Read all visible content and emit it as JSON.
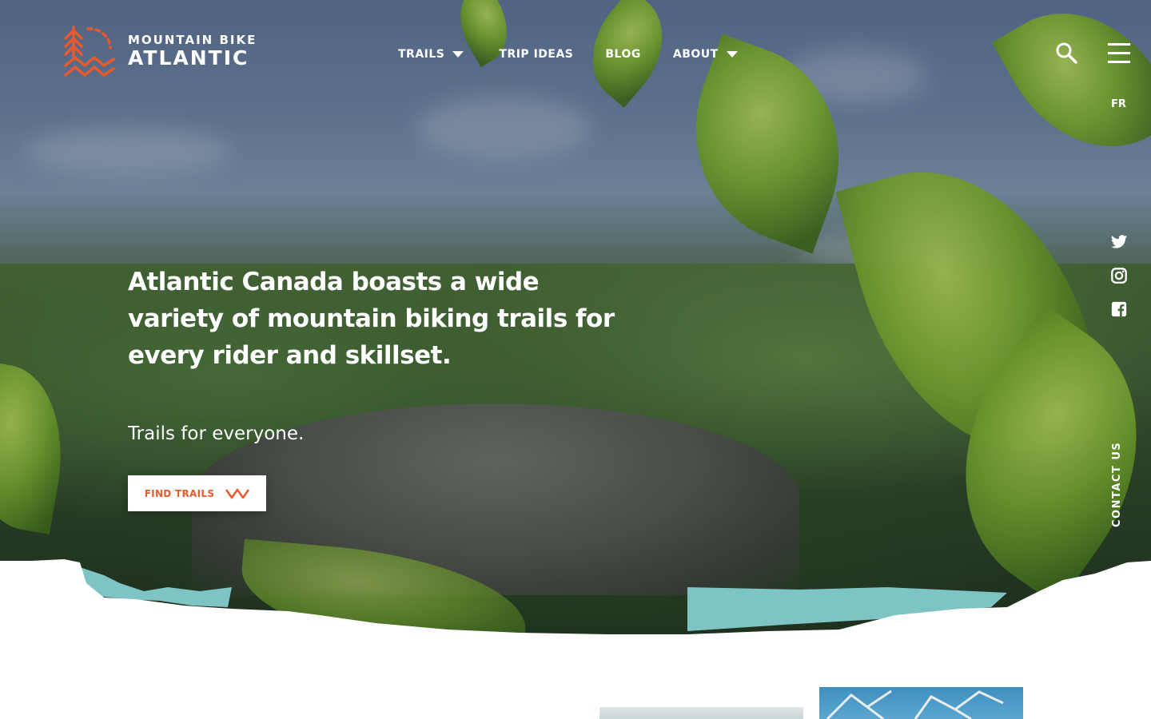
{
  "brand": {
    "line1": "MOUNTAIN BIKE",
    "line2": "ATLANTIC",
    "accent_color": "#e85a2c"
  },
  "nav": {
    "items": [
      {
        "label": "TRAILS",
        "has_dropdown": true
      },
      {
        "label": "TRIP IDEAS",
        "has_dropdown": false
      },
      {
        "label": "BLOG",
        "has_dropdown": false
      },
      {
        "label": "ABOUT",
        "has_dropdown": true
      }
    ]
  },
  "header_tools": {
    "search_icon": "search-icon",
    "menu_icon": "hamburger-menu-icon",
    "language": "FR"
  },
  "social": {
    "icons": [
      "twitter-icon",
      "instagram-icon",
      "facebook-icon"
    ]
  },
  "contact_tab": {
    "label": "CONTACT US"
  },
  "hero": {
    "headline": "Atlantic Canada boasts a wide variety of mountain biking trails for every rider and skillset.",
    "subhead": "Trails for everyone.",
    "cta_label": "FIND TRAILS",
    "cta_icon": "mountain-zigzag-icon"
  },
  "colors": {
    "teal_accent": "#7ec4c4",
    "white": "#ffffff"
  }
}
